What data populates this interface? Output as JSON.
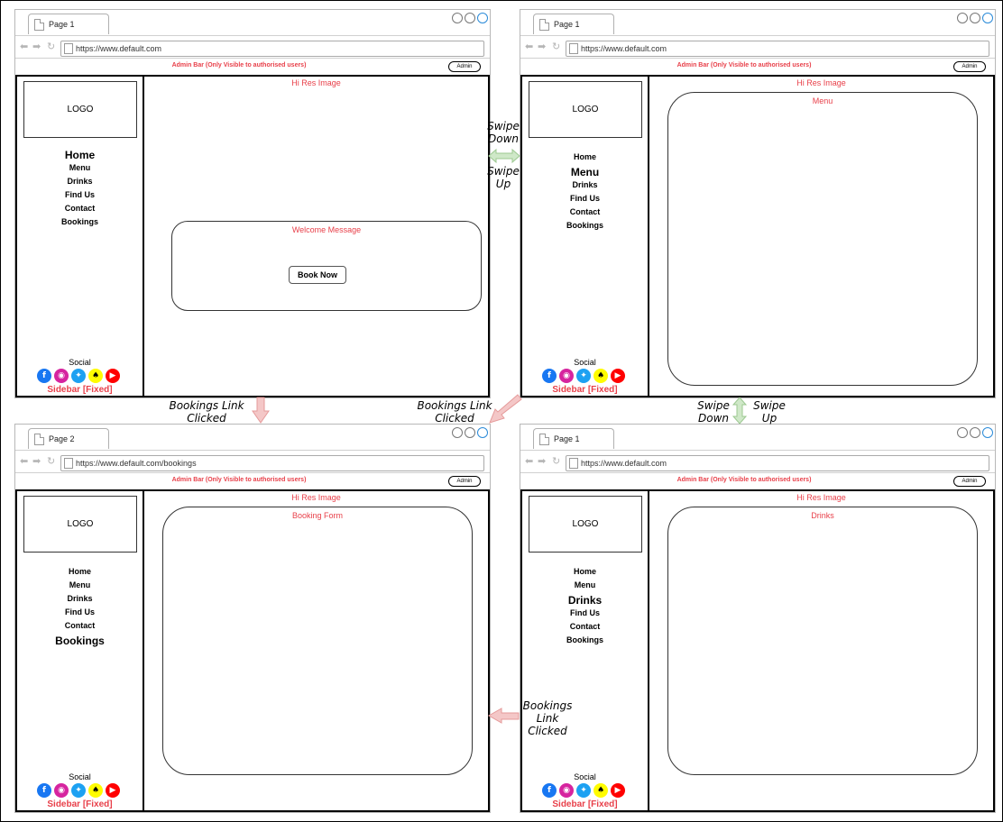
{
  "colors": {
    "accent_red": "#e8404a",
    "arrow_pink": "#f4c7c7",
    "arrow_green": "#cfe8c8"
  },
  "frames": [
    {
      "tab": "Page 1",
      "url": "https://www.default.com",
      "admin_bar": "Admin Bar (Only Visible to authorised users)",
      "admin_button": "Admin",
      "logo": "LOGO",
      "nav": [
        "Home",
        "Menu",
        "Drinks",
        "Find Us",
        "Contact",
        "Bookings"
      ],
      "active": "Home",
      "social": "Social",
      "sidebar_label": "Sidebar [Fixed]",
      "hires": "Hi Res Image",
      "panel_title": "Welcome Message",
      "button": "Book Now"
    },
    {
      "tab": "Page 1",
      "url": "https://www.default.com",
      "admin_bar": "Admin Bar (Only Visible to authorised users)",
      "admin_button": "Admin",
      "logo": "LOGO",
      "nav": [
        "Home",
        "Menu",
        "Drinks",
        "Find Us",
        "Contact",
        "Bookings"
      ],
      "active": "Menu",
      "social": "Social",
      "sidebar_label": "Sidebar [Fixed]",
      "hires": "Hi Res Image",
      "panel_title": "Menu"
    },
    {
      "tab": "Page 2",
      "url": "https://www.default.com/bookings",
      "admin_bar": "Admin Bar (Only Visible to authorised users)",
      "admin_button": "Admin",
      "logo": "LOGO",
      "nav": [
        "Home",
        "Menu",
        "Drinks",
        "Find Us",
        "Contact",
        "Bookings"
      ],
      "active": "Bookings",
      "social": "Social",
      "sidebar_label": "Sidebar [Fixed]",
      "hires": "Hi Res Image",
      "panel_title": "Booking Form"
    },
    {
      "tab": "Page 1",
      "url": "https://www.default.com",
      "admin_bar": "Admin Bar (Only Visible to authorised users)",
      "admin_button": "Admin",
      "logo": "LOGO",
      "nav": [
        "Home",
        "Menu",
        "Drinks",
        "Find Us",
        "Contact",
        "Bookings"
      ],
      "active": "Drinks",
      "social": "Social",
      "sidebar_label": "Sidebar [Fixed]",
      "hires": "Hi Res Image",
      "panel_title": "Drinks"
    }
  ],
  "social_icons": [
    "facebook-icon",
    "instagram-icon",
    "twitter-icon",
    "snapchat-icon",
    "youtube-icon"
  ],
  "annotations": {
    "swipe_down_top": "Swipe\nDown",
    "swipe_up_top": "Swipe\nUp",
    "swipe_down_right": "Swipe\nDown",
    "swipe_up_right": "Swipe\nUp",
    "bookings_left": "Bookings Link\nClicked",
    "bookings_middle": "Bookings Link\nClicked",
    "bookings_bottom": "Bookings\nLink\nClicked"
  }
}
